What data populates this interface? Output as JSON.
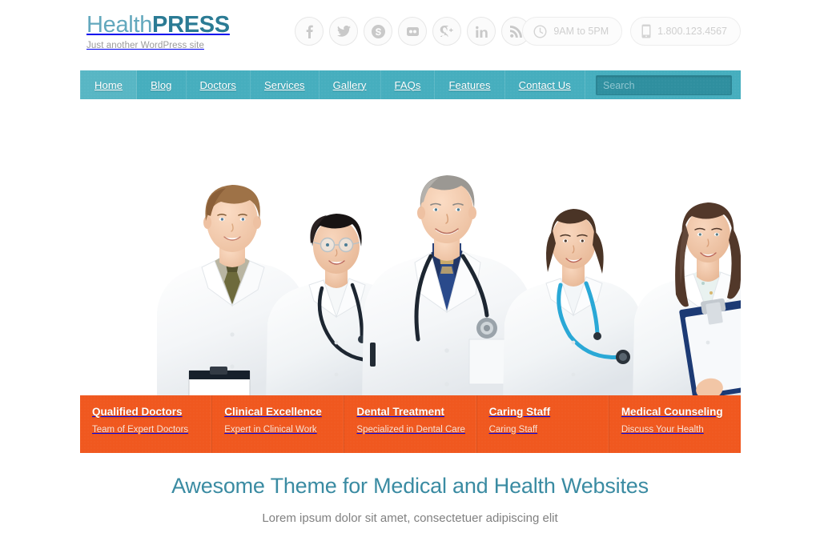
{
  "header": {
    "logo_light": "Health",
    "logo_bold": "PRESS",
    "tagline": "Just another WordPress site",
    "social": [
      {
        "name": "facebook-icon",
        "label": "Facebook"
      },
      {
        "name": "twitter-icon",
        "label": "Twitter"
      },
      {
        "name": "skype-icon",
        "label": "Skype"
      },
      {
        "name": "flickr-icon",
        "label": "Flickr"
      },
      {
        "name": "google-plus-icon",
        "label": "Google Plus"
      },
      {
        "name": "linkedin-icon",
        "label": "LinkedIn"
      },
      {
        "name": "rss-icon",
        "label": "RSS"
      }
    ],
    "hours": "9AM to 5PM",
    "phone": "1.800.123.4567"
  },
  "nav": {
    "items": [
      {
        "label": "Home",
        "active": true
      },
      {
        "label": "Blog",
        "active": false
      },
      {
        "label": "Doctors",
        "active": false
      },
      {
        "label": "Services",
        "active": false
      },
      {
        "label": "Gallery",
        "active": false
      },
      {
        "label": "FAQs",
        "active": false
      },
      {
        "label": "Features",
        "active": false
      },
      {
        "label": "Contact Us",
        "active": false
      }
    ],
    "search": {
      "value": "",
      "placeholder": "Search"
    }
  },
  "hero": {
    "alt": "Team of five smiling doctors in white coats on white background",
    "features": [
      {
        "title": "Qualified Doctors",
        "subtitle": "Team of Expert Doctors"
      },
      {
        "title": "Clinical Excellence",
        "subtitle": "Expert in Clinical Work"
      },
      {
        "title": "Dental Treatment",
        "subtitle": "Specialized in Dental Care"
      },
      {
        "title": "Caring Staff",
        "subtitle": "Caring Staff"
      },
      {
        "title": "Medical Counseling",
        "subtitle": "Discuss Your Health"
      }
    ]
  },
  "intro": {
    "heading": "Awesome Theme for Medical and Health Websites",
    "subheading": "Lorem ipsum dolor sit amet, consectetuer adipiscing elit"
  },
  "colors": {
    "teal": "#46aebe",
    "teal_dark": "#2f8f9f",
    "orange": "#f0581f",
    "heading": "#3a8ba2",
    "logo_light": "#63a8bd",
    "logo_bold": "#2b7b94"
  }
}
